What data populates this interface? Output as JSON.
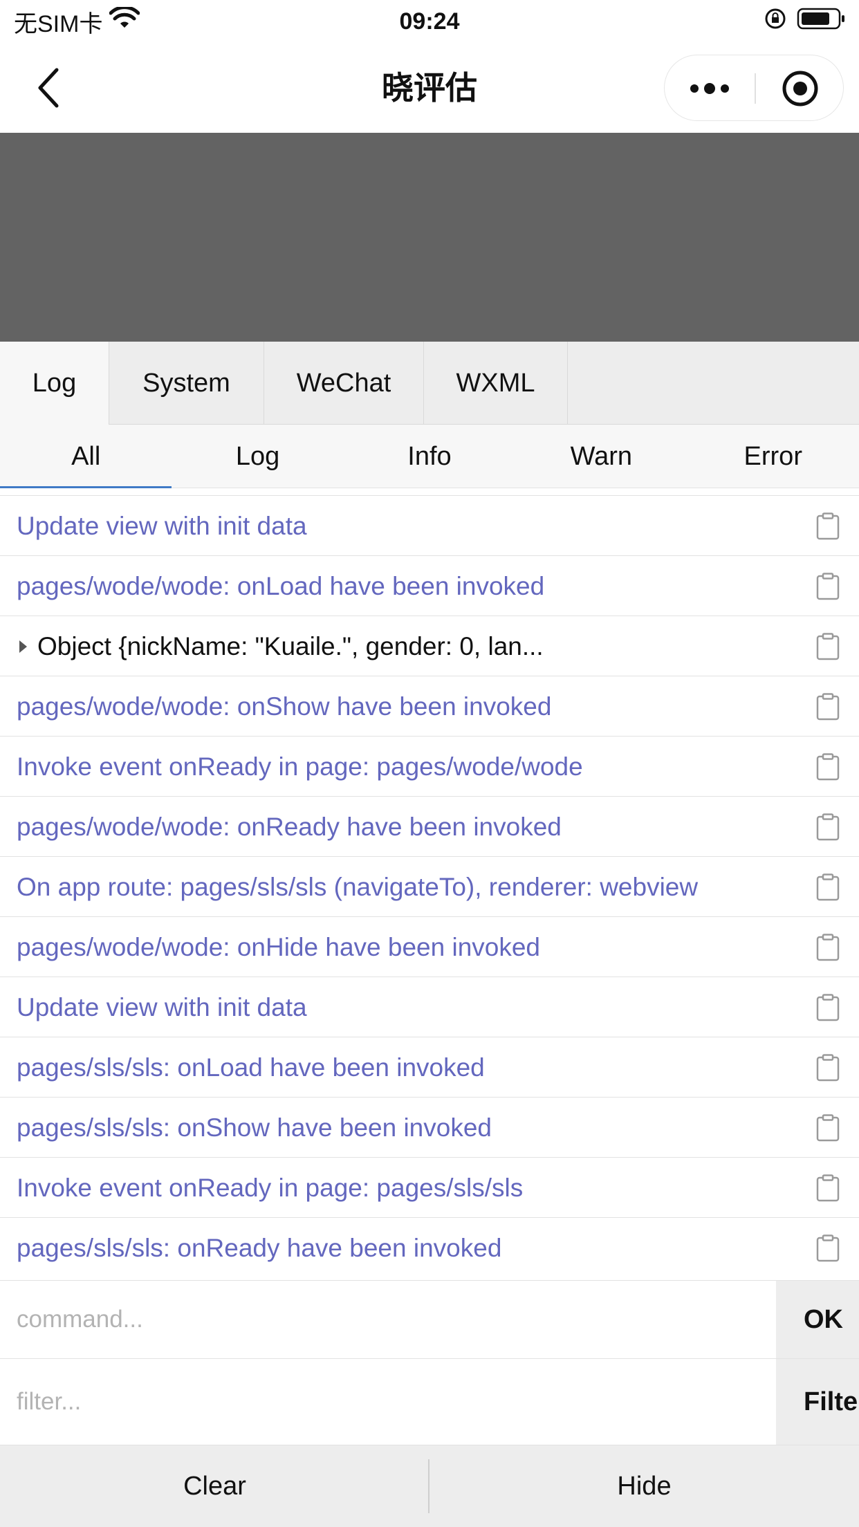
{
  "status_bar": {
    "carrier": "无SIM卡",
    "time": "09:24"
  },
  "nav": {
    "title": "晓评估"
  },
  "tabs": [
    {
      "label": "Log"
    },
    {
      "label": "System"
    },
    {
      "label": "WeChat"
    },
    {
      "label": "WXML"
    }
  ],
  "filter_tabs": [
    {
      "label": "All",
      "active": true
    },
    {
      "label": "Log"
    },
    {
      "label": "Info"
    },
    {
      "label": "Warn"
    },
    {
      "label": "Error"
    }
  ],
  "logs": [
    {
      "text": "Update view with init data"
    },
    {
      "text": "pages/wode/wode: onLoad have been invoked"
    },
    {
      "text": "Object {nickName: \"Kuaile.\", gender: 0, lan..."
    },
    {
      "text": "pages/wode/wode: onShow have been invoked"
    },
    {
      "text": "Invoke event onReady in page: pages/wode/wode"
    },
    {
      "text": "pages/wode/wode: onReady have been invoked"
    },
    {
      "text": "On app route: pages/sls/sls (navigateTo), renderer: webview"
    },
    {
      "text": "pages/wode/wode: onHide have been invoked"
    },
    {
      "text": "Update view with init data"
    },
    {
      "text": "pages/sls/sls: onLoad have been invoked"
    },
    {
      "text": "pages/sls/sls: onShow have been invoked"
    },
    {
      "text": "Invoke event onReady in page: pages/sls/sls"
    },
    {
      "text": "pages/sls/sls: onReady have been invoked"
    }
  ],
  "command": {
    "placeholder": "command...",
    "button": "OK"
  },
  "filter": {
    "placeholder": "filter...",
    "button": "Filter"
  },
  "bottom": {
    "clear": "Clear",
    "hide": "Hide"
  },
  "colors": {
    "log_text": "#6367be",
    "page_content_bg": "#636363",
    "active_tab_underline": "#3f7ac6"
  }
}
